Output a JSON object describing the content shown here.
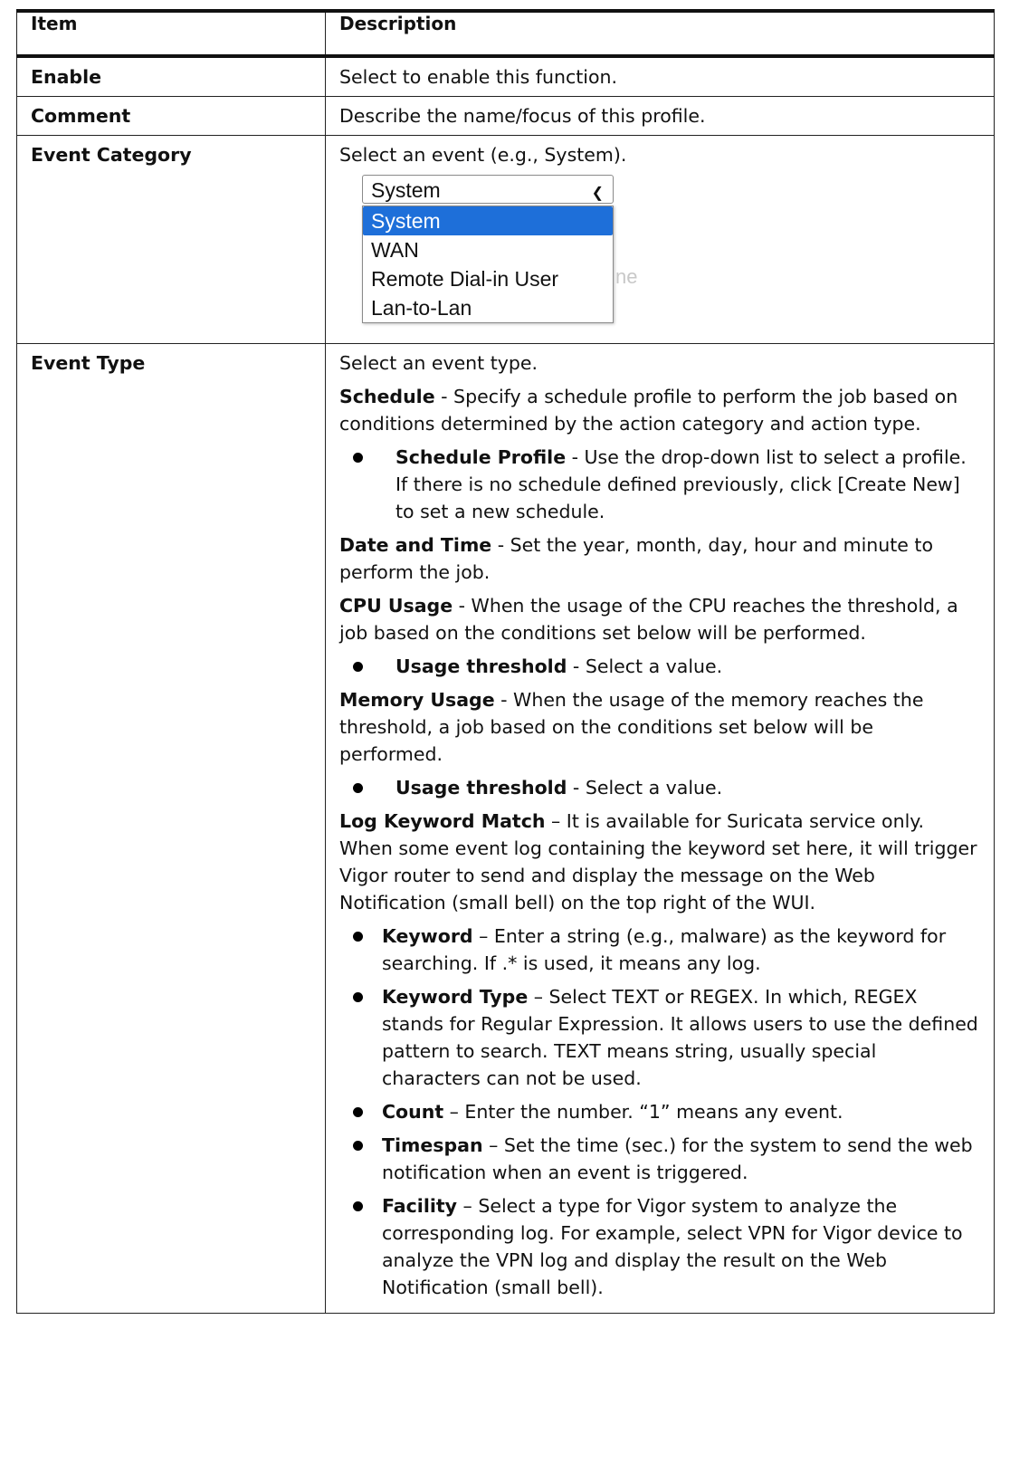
{
  "table": {
    "header": {
      "item": "Item",
      "description": "Description"
    },
    "rows": {
      "enable": {
        "item": "Enable",
        "desc": "Select to enable this function."
      },
      "comment": {
        "item": "Comment",
        "desc": "Describe the name/focus of this profile."
      },
      "category": {
        "item": "Event Category",
        "desc": "Select an event (e.g., System).",
        "dropdown": {
          "selected": "System",
          "options": [
            "System",
            "WAN",
            "Remote Dial-in User",
            "Lan-to-Lan"
          ],
          "ghost": "ne"
        }
      },
      "type": {
        "item": "Event Type",
        "intro": "Select an event type.",
        "schedule": {
          "term": "Schedule",
          "text": " - Specify a schedule profile to perform the job based on conditions determined by the action category and action type."
        },
        "schedule_profile": {
          "term": "Schedule Profile",
          "text": " - Use the drop-down list to select a profile. If there is no schedule defined previously, click [Create New] to set a new schedule."
        },
        "date_time": {
          "term": "Date and Time",
          "text": " - Set the year, month, day, hour and minute to perform the job."
        },
        "cpu": {
          "term": "CPU Usage",
          "text": " - When the usage of the CPU reaches the threshold, a job based on the conditions set below will be performed."
        },
        "cpu_threshold": {
          "term": "Usage threshold",
          "text": " - Select a value."
        },
        "memory": {
          "term": "Memory Usage",
          "text": " - When the usage of the memory reaches the threshold, a job based on the conditions set below will be performed."
        },
        "memory_threshold": {
          "term": "Usage threshold",
          "text": " - Select a value."
        },
        "log": {
          "term": "Log Keyword Match",
          "text": " – It is available for Suricata service only. When some event log containing the keyword set here, it will trigger Vigor router to send and display the message on the Web Notification (small bell) on the top right of the WUI."
        },
        "keyword": {
          "term": "Keyword",
          "text": " – Enter a string (e.g., malware) as the keyword for searching. If .* is used, it means any log."
        },
        "keyword_type": {
          "term": "Keyword Type",
          "text": " – Select TEXT or REGEX. In which, REGEX stands for Regular Expression. It allows users to use the defined pattern to search. TEXT means string, usually special characters can not be used."
        },
        "count": {
          "term": "Count",
          "text": " – Enter the number. “1” means any event."
        },
        "timespan": {
          "term": "Timespan",
          "text": " – Set the time (sec.) for the system to send the web notification when an event is triggered."
        },
        "facility": {
          "term": "Facility",
          "text": " – Select a type for Vigor system to analyze the corresponding log. For example, select VPN for Vigor device to analyze the VPN log and display the result on the Web Notification (small bell)."
        }
      }
    }
  }
}
